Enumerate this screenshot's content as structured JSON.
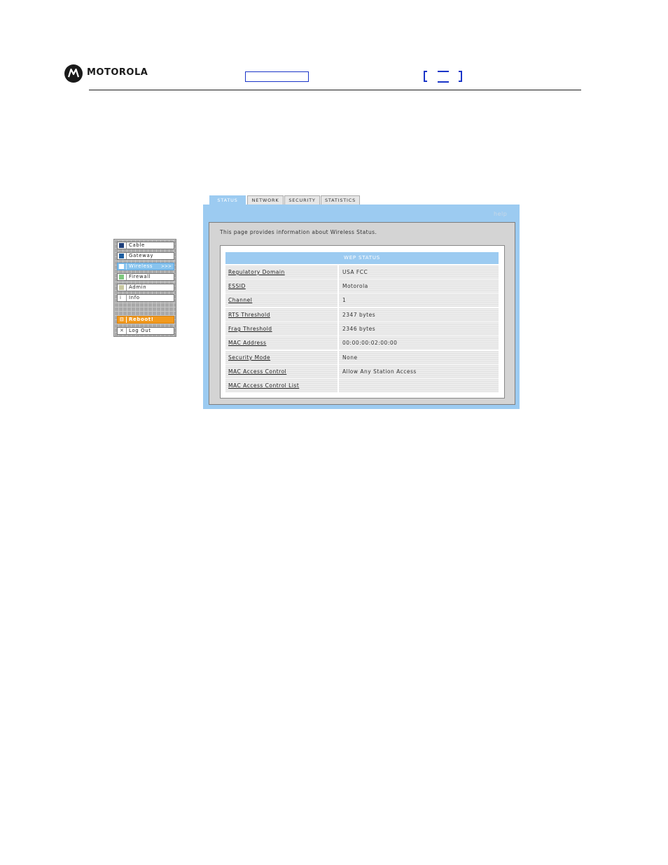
{
  "header": {
    "brand": "MOTOROLA"
  },
  "nav": {
    "items": [
      {
        "label": "Cable",
        "color": "#1f3f7a"
      },
      {
        "label": "Gateway",
        "color": "#1f5fa0"
      },
      {
        "label": "Wireless",
        "color": "#88c4ee",
        "active": true
      },
      {
        "label": "Firewall",
        "color": "#7ec87e"
      },
      {
        "label": "Admin",
        "color": "#c8c8a0"
      },
      {
        "label": "Info",
        "glyph": "i"
      },
      {
        "label": "Reboot!",
        "glyph": "⊟"
      },
      {
        "label": "Log Out",
        "glyph": "✕"
      }
    ],
    "active_arrow": ">>>"
  },
  "tabs": [
    {
      "label": "STATUS",
      "active": true
    },
    {
      "label": "NETWORK"
    },
    {
      "label": "SECURITY"
    },
    {
      "label": "STATISTICS"
    }
  ],
  "help_label": "help",
  "description": "This page provides information about Wireless Status.",
  "table": {
    "title": "WEP STATUS",
    "rows": [
      {
        "key": "Regulatory Domain",
        "value": "USA FCC"
      },
      {
        "key": "ESSID",
        "value": "Motorola"
      },
      {
        "key": "Channel",
        "value": "1"
      },
      {
        "key": "RTS Threshold",
        "value": "2347  bytes"
      },
      {
        "key": "Frag Threshold",
        "value": "2346  bytes"
      },
      {
        "key": "MAC Address",
        "value": "00:00:00:02:00:00"
      },
      {
        "key": "Security Mode",
        "value": "None"
      },
      {
        "key": "MAC Access Control",
        "value": "Allow Any Station Access"
      },
      {
        "key": "MAC Access Control List",
        "value": ""
      }
    ]
  },
  "colors": {
    "accent": "#9ccbf1",
    "reboot": "#f29a1e",
    "header_blue": "#1a35c8"
  }
}
